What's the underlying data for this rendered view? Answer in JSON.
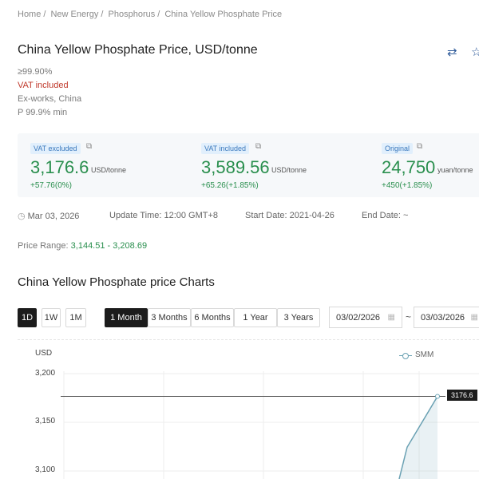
{
  "breadcrumb": [
    "Home",
    "New Energy",
    "Phosphorus",
    "China Yellow Phosphate Price"
  ],
  "header": {
    "title": "China Yellow Phosphate Price, USD/tonne",
    "icons": [
      "swap-icon",
      "star-icon"
    ]
  },
  "specs": [
    "≥99.90%",
    "VAT included",
    "Ex-works, China",
    "P 99.9% min"
  ],
  "prices": [
    {
      "badge": "VAT excluded",
      "value": "3,176.6",
      "unit": "USD/tonne",
      "change": "+57.76(0%)"
    },
    {
      "badge": "VAT included",
      "value": "3,589.56",
      "unit": "USD/tonne",
      "change": "+65.26(+1.85%)"
    },
    {
      "badge": "Original",
      "value": "24,750",
      "unit": "yuan/tonne",
      "change": "+450(+1.85%)"
    }
  ],
  "meta": {
    "date": "Mar 03, 2026",
    "update_time": "Update Time: 12:00 GMT+8",
    "start_date": "Start Date: 2021-04-26",
    "end_date": "End Date: ~"
  },
  "price_range": {
    "label": "Price Range:",
    "value": "3,144.51 - 3,208.69"
  },
  "section_title": "China Yellow Phosphate price Charts",
  "controls": {
    "interval_buttons": [
      "1D",
      "1W",
      "1M"
    ],
    "period_buttons": [
      "1 Month",
      "3 Months",
      "6 Months",
      "1 Year",
      "3 Years"
    ],
    "active_interval": "1D",
    "active_period": "1 Month",
    "date_from": "03/02/2026",
    "date_to": "03/03/2026",
    "separator": "~"
  },
  "colors": {
    "green": "#2a8f4e",
    "red": "#c0392b",
    "badge_bg": "#e1effc",
    "active_btn": "#1c1c1c",
    "line": "#6aa1b3"
  },
  "chart_data": {
    "type": "line",
    "ylabel": "USD",
    "yticks": [
      "3,200",
      "3,150",
      "3,100"
    ],
    "ylim": [
      3100,
      3200
    ],
    "legend": [
      "SMM"
    ],
    "legend_position": "top-right",
    "current_value_tag": "3176.6",
    "grid": true,
    "series": [
      {
        "name": "SMM",
        "values": [
          3118.82,
          3176.6
        ]
      }
    ]
  }
}
